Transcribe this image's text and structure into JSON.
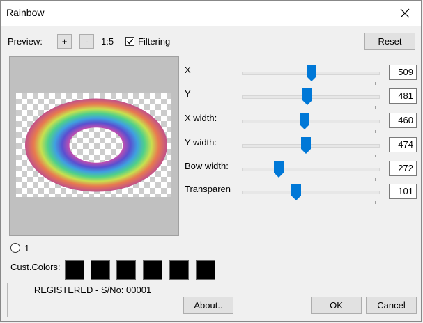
{
  "window": {
    "title": "Rainbow"
  },
  "toolbar": {
    "preview_label": "Preview:",
    "zoom_in": "+",
    "zoom_out": "-",
    "zoom_level": "1:5",
    "filtering_label": "Filtering",
    "filtering_checked": true,
    "reset_label": "Reset"
  },
  "params": [
    {
      "label": "X",
      "value": "509",
      "level": 0.51
    },
    {
      "label": "Y",
      "value": "481",
      "level": 0.48
    },
    {
      "label": "X width:",
      "value": "460",
      "level": 0.46
    },
    {
      "label": "Y width:",
      "value": "474",
      "level": 0.47
    },
    {
      "label": "Bow width:",
      "value": "272",
      "level": 0.27
    },
    {
      "label": "Transparen",
      "value": "101",
      "level": 0.4
    }
  ],
  "radio": {
    "label": "1",
    "selected": false
  },
  "cust_colors": {
    "label": "Cust.Colors:",
    "swatches": [
      "#000000",
      "#000000",
      "#000000",
      "#000000",
      "#000000",
      "#000000"
    ]
  },
  "registration": {
    "text": "REGISTERED - S/No: 00001"
  },
  "buttons": {
    "about": "About..",
    "ok": "OK",
    "cancel": "Cancel"
  },
  "colors": {
    "accent": "#0078d7",
    "preview_bg": "#c0c0c0"
  }
}
